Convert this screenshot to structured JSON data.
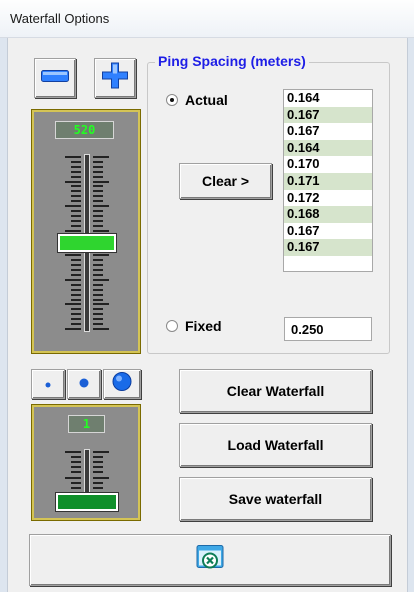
{
  "window": {
    "title": "Waterfall Options"
  },
  "controls": {
    "minus_icon": "minus-icon",
    "plus_icon": "plus-icon"
  },
  "gain_slider": {
    "value": "520",
    "level": 0.5
  },
  "ping_spacing": {
    "title": "Ping Spacing (meters)",
    "actual_label": "Actual",
    "fixed_label": "Fixed",
    "selected": "Actual",
    "clear_button": "Clear >",
    "values": [
      "0.164",
      "0.167",
      "0.167",
      "0.164",
      "0.170",
      "0.171",
      "0.172",
      "0.168",
      "0.167",
      "0.167"
    ],
    "fixed_value": "0.250"
  },
  "dot_size": {
    "options": [
      "small-dot-icon",
      "medium-dot-icon",
      "large-dot-icon"
    ]
  },
  "width_slider": {
    "value": "1",
    "level": 0.0
  },
  "buttons": {
    "clear_waterfall": "Clear Waterfall",
    "load_waterfall": "Load Waterfall",
    "save_waterfall": "Save waterfall",
    "close_icon": "close-window-icon"
  },
  "colors": {
    "accent_blue": "#1e1ee6",
    "slider_green": "#2fd52f",
    "row_alt": "#d6e4cc"
  }
}
